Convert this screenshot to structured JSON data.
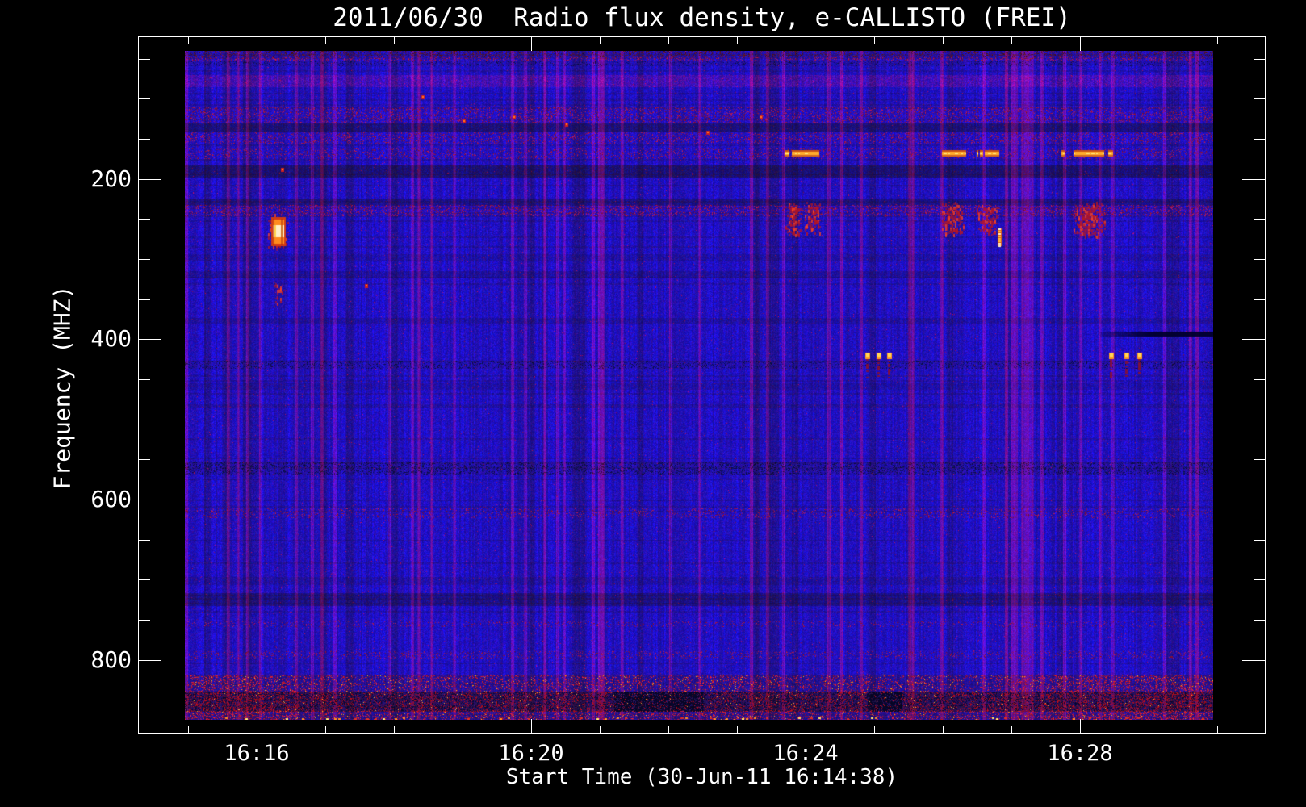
{
  "chart_data": {
    "type": "heatmap",
    "title": "2011/06/30  Radio flux density, e-CALLISTO (FREI)",
    "xlabel": "Start Time (30-Jun-11 16:14:38)",
    "ylabel": "Frequency (MHZ)",
    "legend": "none",
    "grid": "off",
    "x_axis": {
      "unit": "minutes after 16:00 UT",
      "range": [
        14.27,
        30.7
      ],
      "major_ticks": [
        {
          "value": 16,
          "label": "16:16"
        },
        {
          "value": 20,
          "label": "16:20"
        },
        {
          "value": 24,
          "label": "16:24"
        },
        {
          "value": 28,
          "label": "16:28"
        }
      ],
      "minor_tick_start": 15,
      "minor_tick_end": 30,
      "minor_tick_step": 1
    },
    "y_axis": {
      "unit": "MHz",
      "orientation": "low frequency at top",
      "range": [
        22,
        892
      ],
      "major_ticks": [
        {
          "value": 200,
          "label": "200"
        },
        {
          "value": 400,
          "label": "400"
        },
        {
          "value": 600,
          "label": "600"
        },
        {
          "value": 800,
          "label": "800"
        }
      ],
      "minor_tick_step": 50,
      "minor_tick_min": 50,
      "minor_tick_max": 850
    },
    "data_extent": {
      "t": [
        15.0,
        29.93
      ],
      "f": [
        40,
        874
      ]
    },
    "palette": {
      "background": "#000000",
      "axis": "#ffffff",
      "base_blue": "#1a14d8",
      "bright_blue": "#2828f0",
      "purple": "#4a1cb4",
      "dark_navy": "#0a0a78",
      "maroon": "#8c1428",
      "red": "#c81e28",
      "orange": "#ff9620",
      "yellow": "#ffdc50",
      "white_hot": "#fff0d2",
      "black_line": "#000028"
    },
    "h_bands": [
      {
        "f": [
          40,
          52
        ],
        "style": "maroon",
        "a": 0.5
      },
      {
        "f": [
          40,
          47
        ],
        "style": "darkspeckle",
        "a": 0.4
      },
      {
        "f": [
          52,
          58
        ],
        "style": "darkspeckle",
        "a": 0.22
      },
      {
        "f": [
          70,
          84
        ],
        "style": "purple",
        "a": 0.45
      },
      {
        "f": [
          110,
          130
        ],
        "style": "maroon",
        "a": 0.4
      },
      {
        "f": [
          131,
          141
        ],
        "style": "dark",
        "a": 0.5
      },
      {
        "f": [
          142,
          155
        ],
        "style": "maroon",
        "a": 0.35
      },
      {
        "f": [
          161,
          174
        ],
        "style": "maroon",
        "a": 0.3
      },
      {
        "f": [
          183,
          197
        ],
        "style": "dark",
        "a": 0.55
      },
      {
        "f": [
          224,
          232
        ],
        "style": "dark",
        "a": 0.4
      },
      {
        "f": [
          232,
          246
        ],
        "style": "maroon",
        "a": 0.45
      },
      {
        "f": [
          294,
          302
        ],
        "style": "dark",
        "a": 0.18
      },
      {
        "f": [
          315,
          322
        ],
        "style": "dark",
        "a": 0.25
      },
      {
        "f": [
          373,
          379
        ],
        "style": "dark",
        "a": 0.22
      },
      {
        "f": [
          427,
          436
        ],
        "style": "darkspeckle",
        "a": 0.3
      },
      {
        "f": [
          454,
          462
        ],
        "style": "dark",
        "a": 0.18
      },
      {
        "f": [
          553,
          568
        ],
        "style": "darkspeckle",
        "a": 0.45
      },
      {
        "f": [
          611,
          622
        ],
        "style": "maroon",
        "a": 0.25
      },
      {
        "f": [
          699,
          706
        ],
        "style": "dark",
        "a": 0.18
      },
      {
        "f": [
          717,
          732
        ],
        "style": "dark",
        "a": 0.4
      },
      {
        "f": [
          751,
          758
        ],
        "style": "maroon",
        "a": 0.2
      },
      {
        "f": [
          789,
          798
        ],
        "style": "maroon",
        "a": 0.25
      },
      {
        "f": [
          818,
          840
        ],
        "style": "hotnoise",
        "a": 0.75
      },
      {
        "f": [
          840,
          864
        ],
        "style": "darkhot",
        "a": 0.85
      },
      {
        "f": [
          864,
          874
        ],
        "style": "hotnoise",
        "a": 0.85
      }
    ],
    "bursts": [
      {
        "kind": "bright",
        "t": [
          16.21,
          16.42
        ],
        "f": [
          248,
          284
        ]
      },
      {
        "kind": "cloud",
        "t": [
          16.24,
          16.4
        ],
        "f": [
          324,
          360
        ],
        "a": 0.4
      },
      {
        "kind": "cloud",
        "t": [
          23.7,
          23.93
        ],
        "f": [
          228,
          270
        ],
        "a": 0.85
      },
      {
        "kind": "cloud",
        "t": [
          23.98,
          24.22
        ],
        "f": [
          228,
          268
        ],
        "a": 0.8
      },
      {
        "kind": "cloud",
        "t": [
          25.98,
          26.3
        ],
        "f": [
          228,
          272
        ],
        "a": 0.85
      },
      {
        "kind": "cloud",
        "t": [
          26.49,
          26.78
        ],
        "f": [
          230,
          270
        ],
        "a": 0.8
      },
      {
        "kind": "cloud",
        "t": [
          27.9,
          28.36
        ],
        "f": [
          228,
          272
        ],
        "a": 0.85
      },
      {
        "kind": "dash",
        "t": [
          23.67,
          23.76
        ],
        "f": [
          164,
          172
        ]
      },
      {
        "kind": "dash",
        "t": [
          23.8,
          24.18
        ],
        "f": [
          164,
          172
        ]
      },
      {
        "kind": "dash",
        "t": [
          25.98,
          26.32
        ],
        "f": [
          164,
          172
        ]
      },
      {
        "kind": "dash",
        "t": [
          26.49,
          26.81
        ],
        "f": [
          164,
          172
        ]
      },
      {
        "kind": "dash",
        "t": [
          27.73,
          27.77
        ],
        "f": [
          164,
          172
        ]
      },
      {
        "kind": "dash",
        "t": [
          27.9,
          28.35
        ],
        "f": [
          164,
          172
        ]
      },
      {
        "kind": "dash",
        "t": [
          28.41,
          28.48
        ],
        "f": [
          164,
          172
        ]
      },
      {
        "kind": "streak",
        "t": [
          26.79,
          26.86
        ],
        "f": [
          262,
          284
        ]
      }
    ],
    "rfi_dots": {
      "f": [
        417,
        425
      ],
      "tail_f": 448,
      "times": [
        24.87,
        25.03,
        25.19,
        28.42,
        28.64,
        28.83
      ]
    },
    "speckle_dots": [
      {
        "t": 19.0,
        "f": 126
      },
      {
        "t": 19.73,
        "f": 121
      },
      {
        "t": 20.49,
        "f": 130
      },
      {
        "t": 23.33,
        "f": 121
      },
      {
        "t": 17.57,
        "f": 331
      },
      {
        "t": 16.35,
        "f": 186
      },
      {
        "t": 18.4,
        "f": 96
      },
      {
        "t": 22.55,
        "f": 140
      }
    ],
    "dark_line": {
      "t": [
        28.29,
        29.93
      ],
      "f": [
        391,
        397
      ]
    },
    "bottom_black_patches": [
      [
        21.2,
        22.5
      ],
      [
        24.9,
        25.4
      ]
    ],
    "bottom_hot_patches": [
      [
        15.0,
        16.6
      ],
      [
        27.5,
        29.93
      ]
    ]
  }
}
